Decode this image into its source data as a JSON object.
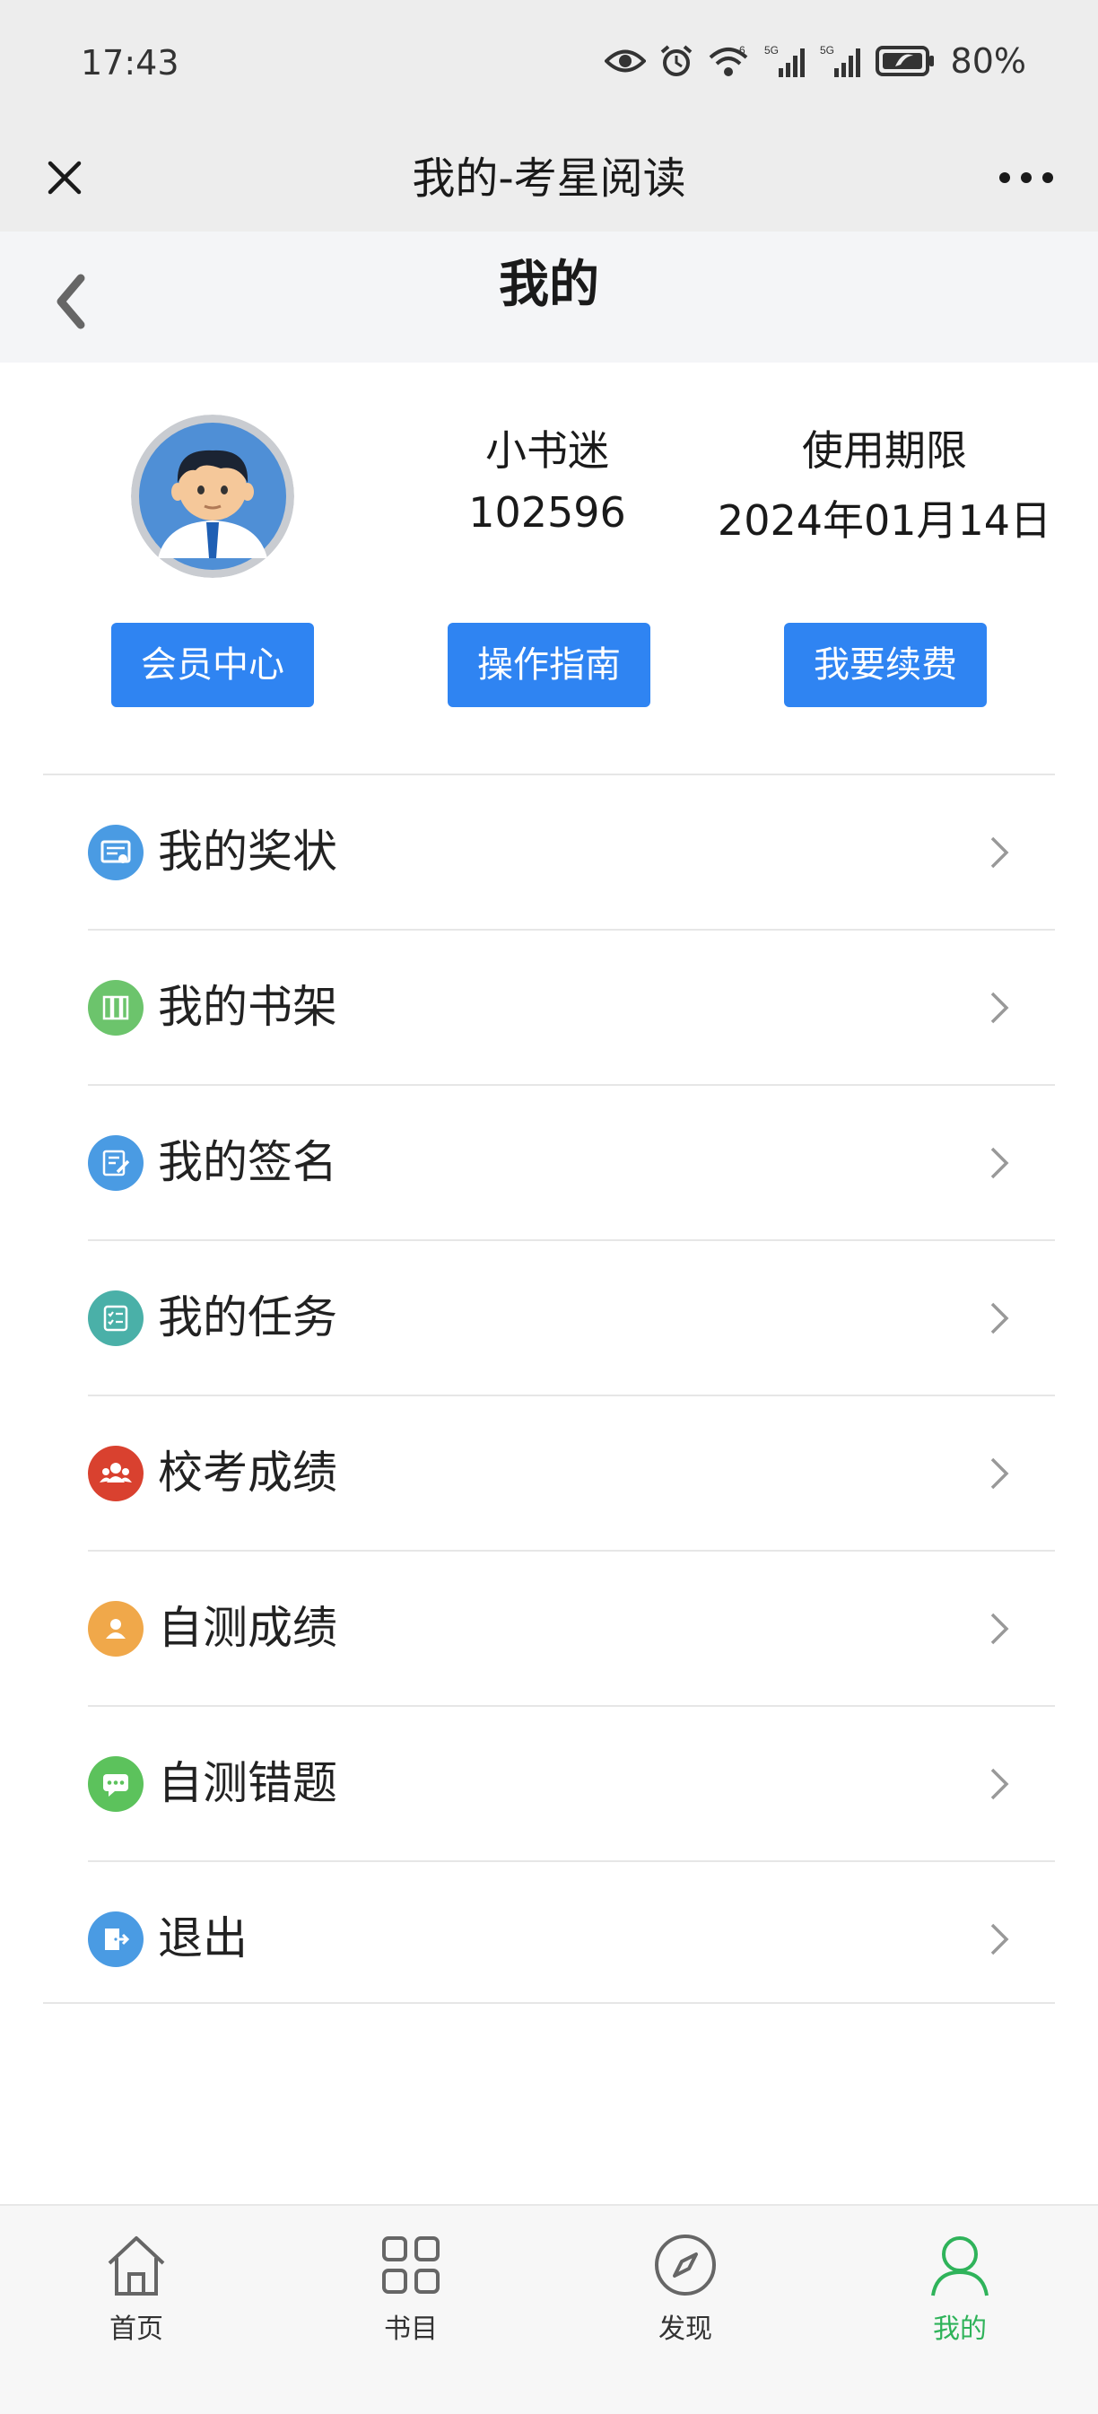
{
  "status_bar": {
    "time": "17:43",
    "network1": "5G",
    "network2": "5G",
    "wifi_tag": "6",
    "battery_pct": "80%"
  },
  "wechat_bar": {
    "title": "我的-考星阅读"
  },
  "page_header": {
    "title": "我的"
  },
  "profile": {
    "nickname": "小书迷",
    "user_id": "102596",
    "expiry_label": "使用期限",
    "expiry_value": "2024年01月14日"
  },
  "actions": [
    {
      "label": "会员中心"
    },
    {
      "label": "操作指南"
    },
    {
      "label": "我要续费"
    }
  ],
  "menu": [
    {
      "label": "我的奖状",
      "icon": "certificate-icon",
      "color": "#4a9be3"
    },
    {
      "label": "我的书架",
      "icon": "bookshelf-icon",
      "color": "#6cc46c"
    },
    {
      "label": "我的签名",
      "icon": "signature-icon",
      "color": "#4a9be3"
    },
    {
      "label": "我的任务",
      "icon": "task-list-icon",
      "color": "#4ab0a8"
    },
    {
      "label": "校考成绩",
      "icon": "group-icon",
      "color": "#d9412f"
    },
    {
      "label": "自测成绩",
      "icon": "person-icon",
      "color": "#f0a84a"
    },
    {
      "label": "自测错题",
      "icon": "chat-icon",
      "color": "#5cc25c"
    },
    {
      "label": "退出",
      "icon": "logout-icon",
      "color": "#4a9be3"
    }
  ],
  "tabbar": [
    {
      "label": "首页",
      "icon": "home-icon"
    },
    {
      "label": "书目",
      "icon": "grid-icon"
    },
    {
      "label": "发现",
      "icon": "compass-icon"
    },
    {
      "label": "我的",
      "icon": "user-icon",
      "active": true
    }
  ],
  "colors": {
    "accent": "#2f84f2",
    "active_tab": "#2fb35a"
  }
}
